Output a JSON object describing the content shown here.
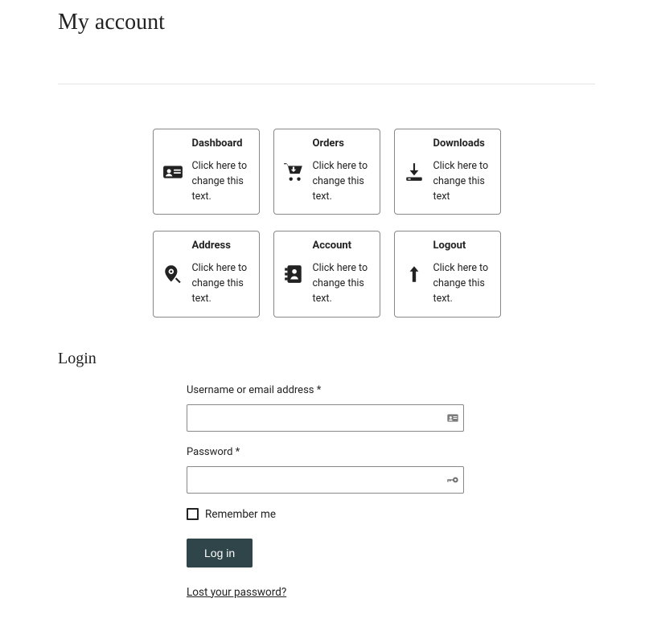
{
  "page": {
    "title": "My account",
    "login_heading": "Login"
  },
  "cards": [
    {
      "title": "Dashboard",
      "desc": "Click here to change this text.",
      "icon": "id-card-icon"
    },
    {
      "title": "Orders",
      "desc": "Click here to change this text.",
      "icon": "cart-icon"
    },
    {
      "title": "Downloads",
      "desc": "Click here to change this text",
      "icon": "download-icon"
    },
    {
      "title": "Address",
      "desc": "Click here to change this text.",
      "icon": "map-pin-icon"
    },
    {
      "title": "Account",
      "desc": "Click here to change this text.",
      "icon": "address-book-icon"
    },
    {
      "title": "Logout",
      "desc": "Click here to change this text.",
      "icon": "arrow-up-icon"
    }
  ],
  "login": {
    "username_label": "Username or email address ",
    "password_label": "Password ",
    "required_mark": "*",
    "remember_label": "Remember me",
    "submit_label": "Log in",
    "lost_password": "Lost your password?"
  }
}
